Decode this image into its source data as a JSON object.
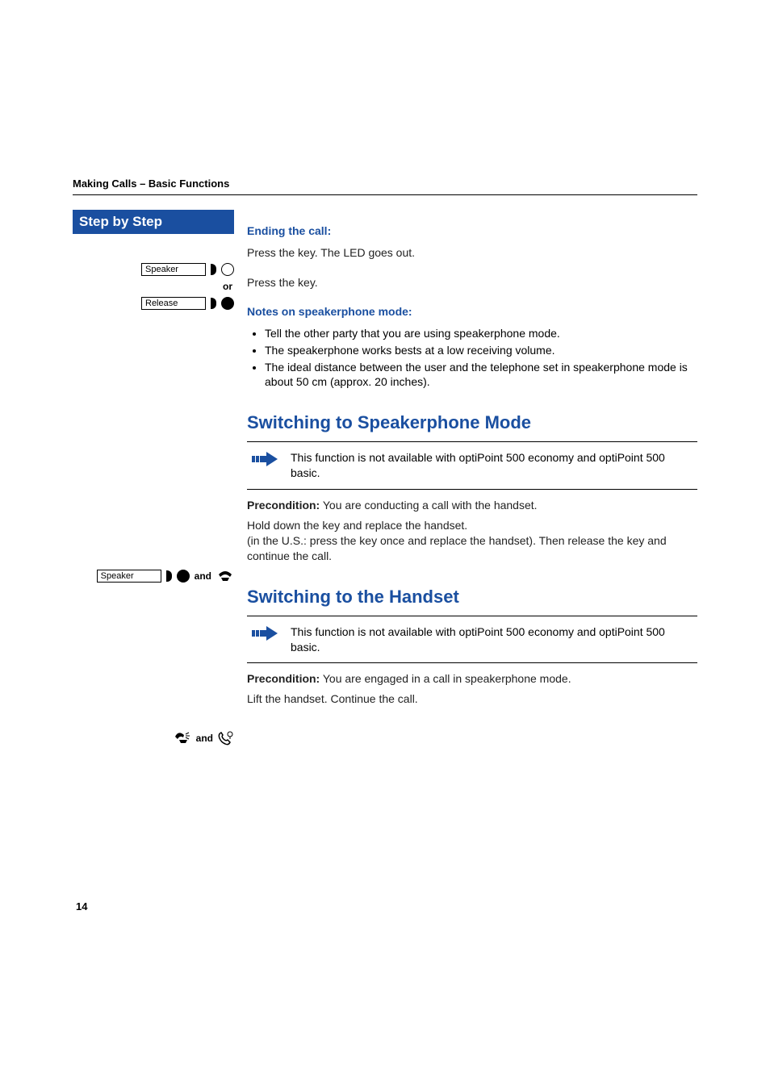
{
  "header": "Making Calls – Basic Functions",
  "step_banner": "Step by Step",
  "sections": {
    "ending": {
      "heading": "Ending the call:",
      "press_led": "Press the key. The LED goes out.",
      "press": "Press the key.",
      "or": "or",
      "speaker_label": "Speaker",
      "release_label": "Release"
    },
    "notes": {
      "heading": "Notes on speakerphone mode:",
      "b1": "Tell the other party that you are using speakerphone mode.",
      "b2": "The speakerphone works bests at a low receiving volume.",
      "b3": "The ideal distance between the user and the telephone set in speakerphone mode is about 50 cm (approx. 20 inches)."
    },
    "speakerphone": {
      "heading": "Switching to Speakerphone Mode",
      "note": "This function is not available with optiPoint 500 economy and optiPoint 500 basic.",
      "precond_label": "Precondition:",
      "precond_text": " You are conducting a call with the handset.",
      "action": "Hold down the key and replace the handset.\n(in the U.S.: press the key once and replace the handset). Then release the key and continue the call.",
      "speaker_label": "Speaker",
      "and": "and"
    },
    "handset": {
      "heading": "Switching to the Handset",
      "note": "This function is not available with optiPoint 500 economy and optiPoint 500 basic.",
      "precond_label": "Precondition:",
      "precond_text": " You are engaged in a call in speakerphone mode.",
      "action": "Lift the handset. Continue the call.",
      "and": "and"
    }
  },
  "page_number": "14"
}
